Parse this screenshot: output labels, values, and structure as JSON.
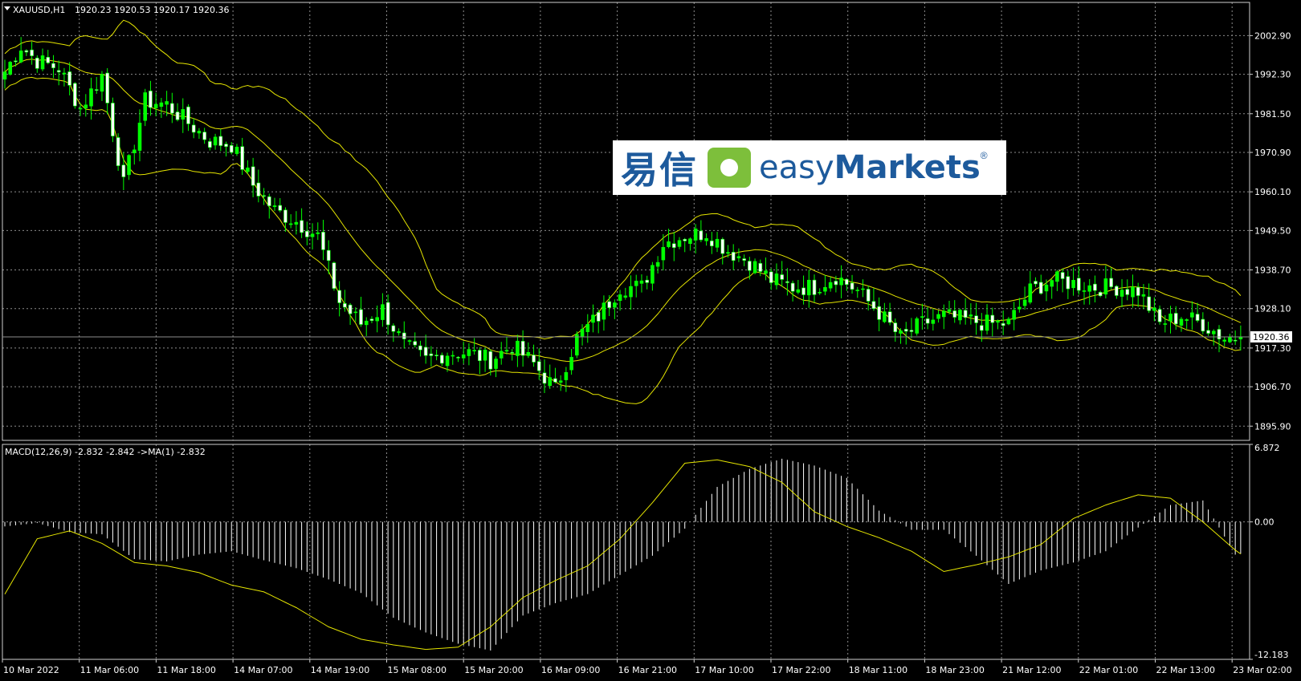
{
  "header": {
    "symbol": "XAUUSD,H1",
    "ohlc": "1920.23 1920.53 1920.17 1920.36",
    "macd_label": "MACD(12,26,9) -2.832 -2.842  ->MA(1) -2.832"
  },
  "logo": {
    "chinese": "易信",
    "brand_light": "easy",
    "brand_bold": "Markets",
    "reg": "®"
  },
  "colors": {
    "bull": "#00ff00",
    "bear": "#ffffff",
    "bands": "#e5e500",
    "grid": "#8c8c8c",
    "signal": "#e5e500",
    "macd_hist": "#ffffff"
  },
  "chart_data": [
    {
      "type": "candlestick",
      "title": "XAUUSD,H1",
      "y_ticks": [
        "2002.90",
        "1992.30",
        "1981.50",
        "1970.90",
        "1960.10",
        "1949.50",
        "1938.70",
        "1928.10",
        "1917.30",
        "1906.70",
        "1895.90"
      ],
      "ylim": [
        1892.0,
        2012.0
      ],
      "current_price": "1920.36",
      "x_ticks": [
        "10 Mar 2022",
        "11 Mar 06:00",
        "11 Mar 18:00",
        "14 Mar 07:00",
        "14 Mar 19:00",
        "15 Mar 08:00",
        "15 Mar 20:00",
        "16 Mar 09:00",
        "16 Mar 21:00",
        "17 Mar 10:00",
        "17 Mar 22:00",
        "18 Mar 11:00",
        "18 Mar 23:00",
        "21 Mar 12:00",
        "22 Mar 01:00",
        "22 Mar 13:00",
        "23 Mar 02:00"
      ],
      "close_keypoints": [
        [
          0,
          1993
        ],
        [
          3,
          2000
        ],
        [
          6,
          1996
        ],
        [
          10,
          1994
        ],
        [
          14,
          1983
        ],
        [
          18,
          1992
        ],
        [
          22,
          1962
        ],
        [
          26,
          1985
        ],
        [
          30,
          1984
        ],
        [
          34,
          1979
        ],
        [
          38,
          1974
        ],
        [
          42,
          1973
        ],
        [
          46,
          1962
        ],
        [
          50,
          1955
        ],
        [
          54,
          1952
        ],
        [
          58,
          1948
        ],
        [
          62,
          1930
        ],
        [
          66,
          1924
        ],
        [
          70,
          1928
        ],
        [
          74,
          1918
        ],
        [
          78,
          1914
        ],
        [
          82,
          1916
        ],
        [
          86,
          1916
        ],
        [
          90,
          1914
        ],
        [
          94,
          1918
        ],
        [
          98,
          1913
        ],
        [
          102,
          1906
        ],
        [
          106,
          1920
        ],
        [
          110,
          1926
        ],
        [
          114,
          1934
        ],
        [
          118,
          1934
        ],
        [
          122,
          1946
        ],
        [
          126,
          1948
        ],
        [
          130,
          1949
        ],
        [
          134,
          1944
        ],
        [
          138,
          1941
        ],
        [
          142,
          1936
        ],
        [
          146,
          1934
        ],
        [
          150,
          1934
        ],
        [
          154,
          1937
        ],
        [
          158,
          1933
        ],
        [
          162,
          1927
        ],
        [
          166,
          1920
        ],
        [
          170,
          1924
        ],
        [
          174,
          1926
        ],
        [
          178,
          1925
        ],
        [
          182,
          1924
        ],
        [
          186,
          1924
        ],
        [
          190,
          1933
        ],
        [
          194,
          1936
        ],
        [
          198,
          1935
        ],
        [
          202,
          1934
        ],
        [
          206,
          1934
        ],
        [
          210,
          1933
        ],
        [
          214,
          1924
        ],
        [
          218,
          1926
        ],
        [
          222,
          1924
        ],
        [
          226,
          1920
        ],
        [
          229,
          1920.36
        ]
      ],
      "candle_count": 230,
      "indicator": "Bollinger Bands (yellow)"
    },
    {
      "type": "histogram+line",
      "title": "MACD(12,26,9) -2.832 -2.842  ->MA(1) -2.832",
      "y_ticks": [
        "6.872",
        "0.00",
        "-12.183"
      ],
      "ylim": [
        -12.183,
        6.872
      ],
      "macd_keypoints": [
        [
          0,
          -0.4
        ],
        [
          6,
          -0.1
        ],
        [
          12,
          -0.9
        ],
        [
          18,
          -1.1
        ],
        [
          24,
          -3.3
        ],
        [
          30,
          -3.5
        ],
        [
          36,
          -2.9
        ],
        [
          42,
          -2.6
        ],
        [
          48,
          -3.4
        ],
        [
          54,
          -4.1
        ],
        [
          60,
          -5.1
        ],
        [
          66,
          -6.3
        ],
        [
          72,
          -8.5
        ],
        [
          78,
          -9.8
        ],
        [
          84,
          -10.8
        ],
        [
          90,
          -11.4
        ],
        [
          96,
          -8.3
        ],
        [
          102,
          -7.2
        ],
        [
          108,
          -6.4
        ],
        [
          114,
          -4.7
        ],
        [
          120,
          -3.0
        ],
        [
          126,
          -0.6
        ],
        [
          132,
          3.1
        ],
        [
          138,
          4.7
        ],
        [
          144,
          5.6
        ],
        [
          150,
          5.0
        ],
        [
          156,
          3.9
        ],
        [
          162,
          1.0
        ],
        [
          168,
          -0.7
        ],
        [
          174,
          -0.7
        ],
        [
          180,
          -3.0
        ],
        [
          186,
          -5.5
        ],
        [
          192,
          -4.3
        ],
        [
          198,
          -3.6
        ],
        [
          204,
          -2.6
        ],
        [
          210,
          -0.5
        ],
        [
          216,
          1.5
        ],
        [
          222,
          1.9
        ],
        [
          228,
          -2.9
        ],
        [
          229,
          -2.832
        ]
      ],
      "signal_keypoints": [
        [
          0,
          -6.4
        ],
        [
          6,
          -1.5
        ],
        [
          12,
          -0.8
        ],
        [
          18,
          -1.9
        ],
        [
          24,
          -3.6
        ],
        [
          30,
          -3.9
        ],
        [
          36,
          -4.5
        ],
        [
          42,
          -5.6
        ],
        [
          48,
          -6.2
        ],
        [
          54,
          -7.6
        ],
        [
          60,
          -9.3
        ],
        [
          66,
          -10.4
        ],
        [
          72,
          -10.9
        ],
        [
          78,
          -11.3
        ],
        [
          84,
          -11.1
        ],
        [
          90,
          -9.3
        ],
        [
          96,
          -6.7
        ],
        [
          102,
          -5.2
        ],
        [
          108,
          -3.9
        ],
        [
          114,
          -1.5
        ],
        [
          120,
          1.7
        ],
        [
          126,
          5.2
        ],
        [
          132,
          5.5
        ],
        [
          138,
          4.9
        ],
        [
          144,
          3.5
        ],
        [
          150,
          0.9
        ],
        [
          156,
          -0.4
        ],
        [
          162,
          -1.4
        ],
        [
          168,
          -2.6
        ],
        [
          174,
          -4.4
        ],
        [
          180,
          -3.8
        ],
        [
          186,
          -3.1
        ],
        [
          192,
          -2.0
        ],
        [
          198,
          0.3
        ],
        [
          204,
          1.5
        ],
        [
          210,
          2.4
        ],
        [
          216,
          2.1
        ],
        [
          222,
          0.0
        ],
        [
          228,
          -2.5
        ],
        [
          229,
          -2.842
        ]
      ]
    }
  ]
}
